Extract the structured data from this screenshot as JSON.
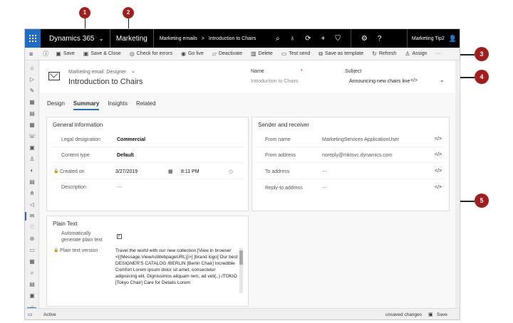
{
  "app": {
    "brand": "Dynamics 365",
    "module": "Marketing",
    "breadcrumb": [
      "Marketing emails",
      ">",
      "Introduction to Chairs"
    ],
    "user": "Marketing Tip2"
  },
  "commands": [
    {
      "label": "Save",
      "icon": "save-icon",
      "glyph": "🖫"
    },
    {
      "label": "Save & Close",
      "icon": "save-close-icon",
      "glyph": "🖫"
    },
    {
      "label": "Check for errors",
      "icon": "check-errors-icon",
      "glyph": "◎"
    },
    {
      "label": "Go live",
      "icon": "go-live-icon",
      "glyph": "◎"
    },
    {
      "label": "Deactivate",
      "icon": "deactivate-icon",
      "glyph": "▱"
    },
    {
      "label": "Delete",
      "icon": "delete-icon",
      "glyph": "🗑"
    },
    {
      "label": "Test send",
      "icon": "test-send-icon",
      "glyph": "▭"
    },
    {
      "label": "Save as template",
      "icon": "save-template-icon",
      "glyph": "⧉"
    },
    {
      "label": "Refresh",
      "icon": "refresh-icon",
      "glyph": "↻"
    },
    {
      "label": "Assign",
      "icon": "assign-icon",
      "glyph": "👤"
    },
    {
      "label": "···",
      "icon": "more-icon",
      "glyph": ""
    }
  ],
  "header": {
    "record_type": "Marketing email: Designer",
    "title": "Introduction to Chairs",
    "name_label": "Name",
    "required_mark": "*",
    "name_value": "Introduction to Chairs",
    "subject_label": "Subject",
    "subject_value": "Announcing new chairs line"
  },
  "tabs": [
    "Design",
    "Summary",
    "Insights",
    "Related"
  ],
  "active_tab": "Summary",
  "general": {
    "title": "General information",
    "rows": [
      {
        "label": "Legal designation",
        "value": "Commercial"
      },
      {
        "label": "Content type",
        "value": "Default"
      },
      {
        "label": "Created on",
        "date": "3/27/2019",
        "time": "8:11 PM"
      },
      {
        "label": "Description",
        "value": "---"
      }
    ]
  },
  "sender": {
    "title": "Sender and receiver",
    "rows": [
      {
        "label": "From name",
        "value": "MarketingServices ApplicationUser"
      },
      {
        "label": "From address",
        "value": "noreply@mktsvc.dynamics.com"
      },
      {
        "label": "To address",
        "value": "---"
      },
      {
        "label": "Reply-to address",
        "value": "---"
      }
    ]
  },
  "plain": {
    "title": "Plain Text",
    "auto_label_1": "Automatically",
    "auto_label_2": "generate plain text",
    "version_label": "Plain text version",
    "text": "Travel the world with our new collection [View in browser <{{Message.ViewAsWebpageURL}}>] [brand logo] Our best DESIGNER'S CATALOG /BERLIN [Berlin Chair] Incredible Comfort Lorem ipsum dolor sit amet, consectetur adipisicing elit. Dignissimos aliquam rem, ad veli(..) /TOKIO [Tokyo Chair] Care for Details Lorem"
  },
  "status": {
    "state": "Active",
    "unsaved": "unsaved changes",
    "save": "Save"
  },
  "callouts": [
    "1",
    "2",
    "3",
    "4",
    "5"
  ],
  "colors": {
    "accent": "#1e6ec8",
    "callout": "#a11e1e",
    "topbar": "#000000"
  }
}
